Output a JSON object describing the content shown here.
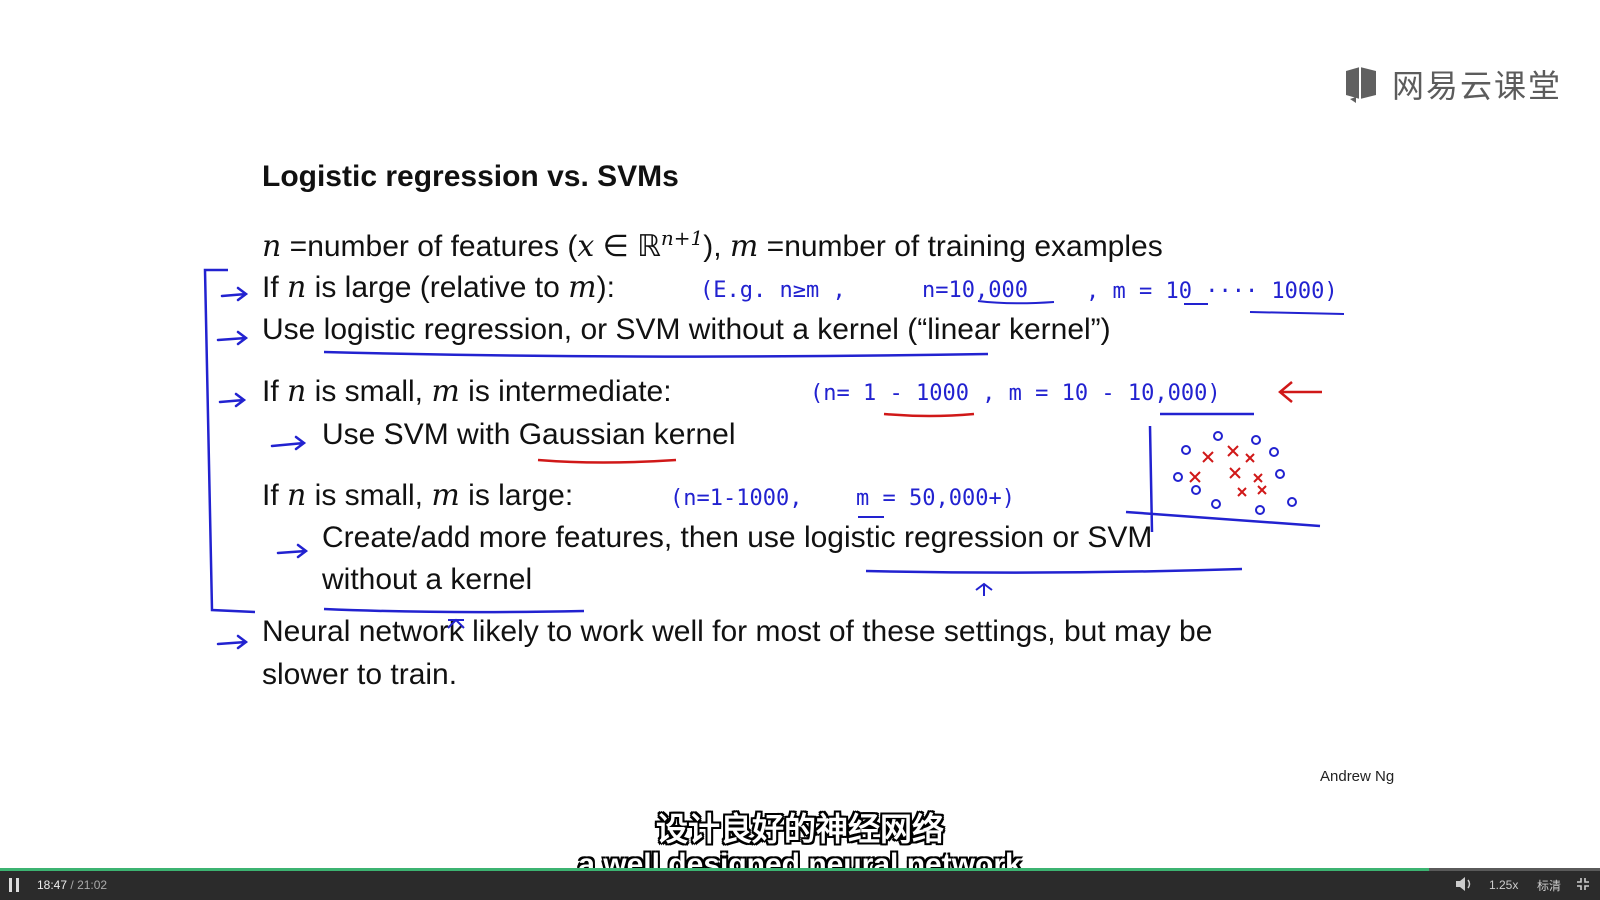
{
  "logo": {
    "text": "网易云课堂",
    "icon": "book-logo-icon"
  },
  "slide": {
    "title": "Logistic regression vs. SVMs",
    "line1": {
      "v1": "n",
      "eq1": " =",
      "t1": "number of features (",
      "v2": "x",
      "in": " ∈ ",
      "R": "ℝ",
      "sup": "n+1",
      "t2": "), ",
      "v3": "m",
      "eq2": " =",
      "t3": "number of training examples"
    },
    "line2": {
      "t1": "If ",
      "v1": "n",
      "t2": " is large (relative to ",
      "v2": "m",
      "t3": "):"
    },
    "line3": "Use logistic regression, or SVM without a kernel (“linear kernel”)",
    "line4": {
      "t1": "If ",
      "v1": "n",
      "t2": " is small,  ",
      "v2": "m",
      "t3": " is intermediate:"
    },
    "line5": "Use SVM with Gaussian kernel",
    "line6": {
      "t1": "If ",
      "v1": "n",
      "t2": " is small, ",
      "v2": "m",
      "t3": " is large:"
    },
    "line7": "Create/add more features, then use logistic regression or SVM",
    "line8": "without a kernel",
    "line9": "Neural network likely to work well for most of these settings, but may be",
    "line10": "slower to train.",
    "author": "Andrew Ng"
  },
  "annotations": {
    "note1": "(E.g.  n≥m ,",
    "note1b": "n=10,000",
    "note1c": ",  m = 10 ···· 1000)",
    "note2": "(n= 1 - 1000 ,  m = 10 - 10,000)",
    "note3": "(n=1-1000,",
    "note3b": "m = 50,000+)",
    "scatter_o": "o",
    "scatter_x": "×"
  },
  "subtitles": {
    "cn": "设计良好的神经网络",
    "en": "a well designed neural network"
  },
  "player": {
    "current_time": "18:47",
    "separator": "/",
    "duration": "21:02",
    "progress": 0.893,
    "speed": "1.25x",
    "quality": "标清",
    "colors": {
      "progress": "#3cb371",
      "bar": "#2b2b2b"
    }
  }
}
